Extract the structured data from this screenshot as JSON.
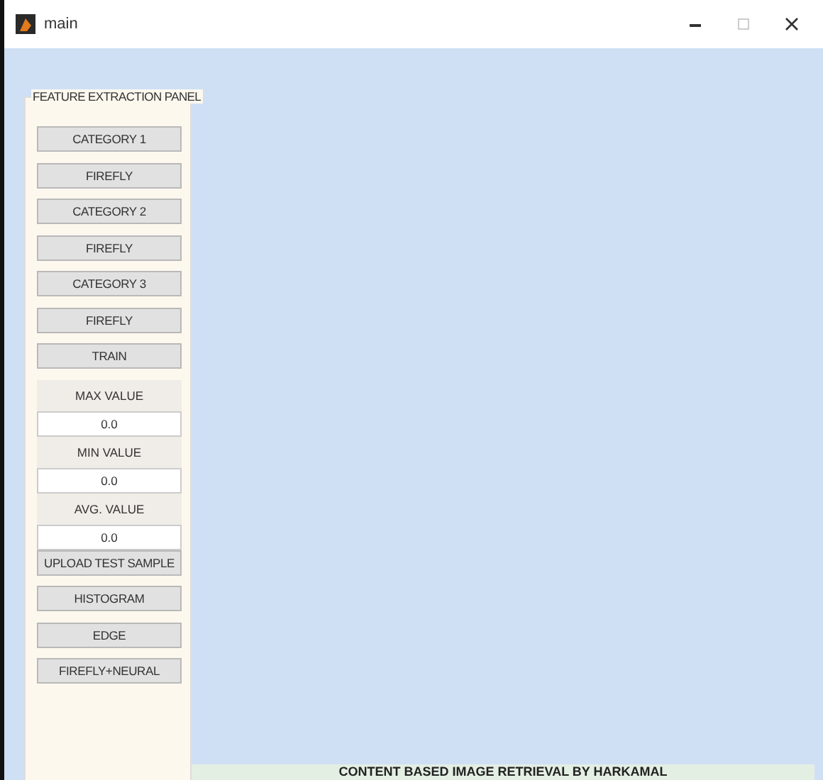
{
  "window": {
    "title": "main"
  },
  "panel": {
    "title": "FEATURE EXTRACTION PANEL",
    "items": [
      {
        "kind": "button",
        "text": "CATEGORY 1"
      },
      {
        "kind": "button",
        "text": "FIREFLY"
      },
      {
        "kind": "button",
        "text": "CATEGORY 2"
      },
      {
        "kind": "button",
        "text": "FIREFLY"
      },
      {
        "kind": "button",
        "text": "CATEGORY 3"
      },
      {
        "kind": "button",
        "text": "FIREFLY"
      },
      {
        "kind": "button",
        "text": "TRAIN"
      },
      {
        "kind": "label",
        "text": "MAX VALUE"
      },
      {
        "kind": "field",
        "text": "0.0"
      },
      {
        "kind": "label",
        "text": "MIN VALUE"
      },
      {
        "kind": "field",
        "text": "0.0"
      },
      {
        "kind": "label",
        "text": "AVG. VALUE"
      },
      {
        "kind": "field",
        "text": "0.0"
      },
      {
        "kind": "button",
        "text": "UPLOAD TEST SAMPLE"
      },
      {
        "kind": "button",
        "text": "HISTOGRAM"
      },
      {
        "kind": "button",
        "text": "EDGE"
      },
      {
        "kind": "button",
        "text": "FIREFLY+NEURAL"
      }
    ]
  },
  "banner": {
    "text": "CONTENT BASED IMAGE RETRIEVAL BY HARKAMAL"
  }
}
